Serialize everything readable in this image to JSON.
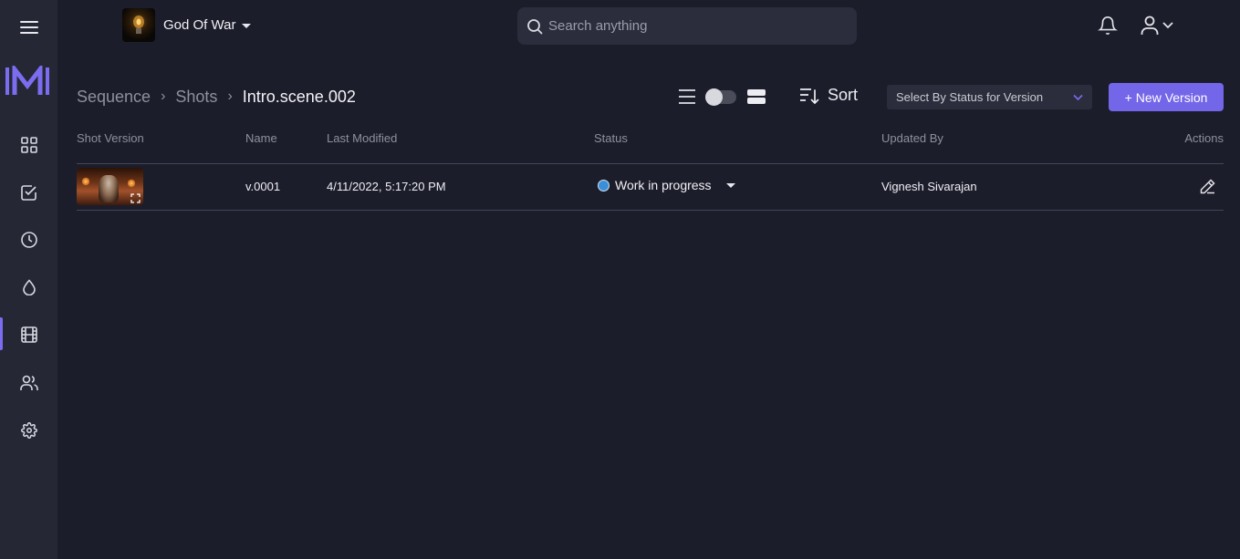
{
  "project": {
    "name": "God Of War"
  },
  "search": {
    "placeholder": "Search anything"
  },
  "sidebar": {
    "active": "shots",
    "items": [
      {
        "name": "menu-icon"
      },
      {
        "name": "dashboard-icon"
      },
      {
        "name": "tasks-icon"
      },
      {
        "name": "clock-icon"
      },
      {
        "name": "drop-icon"
      },
      {
        "name": "film-icon"
      },
      {
        "name": "users-icon"
      },
      {
        "name": "gear-icon"
      }
    ]
  },
  "breadcrumb": {
    "items": [
      "Sequence",
      "Shots"
    ],
    "current": "Intro.scene.002",
    "separator": "›"
  },
  "toolbar": {
    "sort_label": "Sort",
    "status_select": "Select By Status for Version",
    "new_version_label": "New Version",
    "new_version_icon": "+"
  },
  "table": {
    "columns": [
      "Shot Version",
      "Name",
      "Last Modified",
      "Status",
      "Updated By",
      "Actions"
    ],
    "rows": [
      {
        "name": "v.0001",
        "last_modified": "4/11/2022, 5:17:20 PM",
        "status": "Work in progress",
        "status_color": "#3b8fd9",
        "updated_by": "Vignesh Sivarajan"
      }
    ]
  },
  "colors": {
    "accent": "#7466e8",
    "background": "#1c1d2a",
    "sidebar": "#252735"
  }
}
